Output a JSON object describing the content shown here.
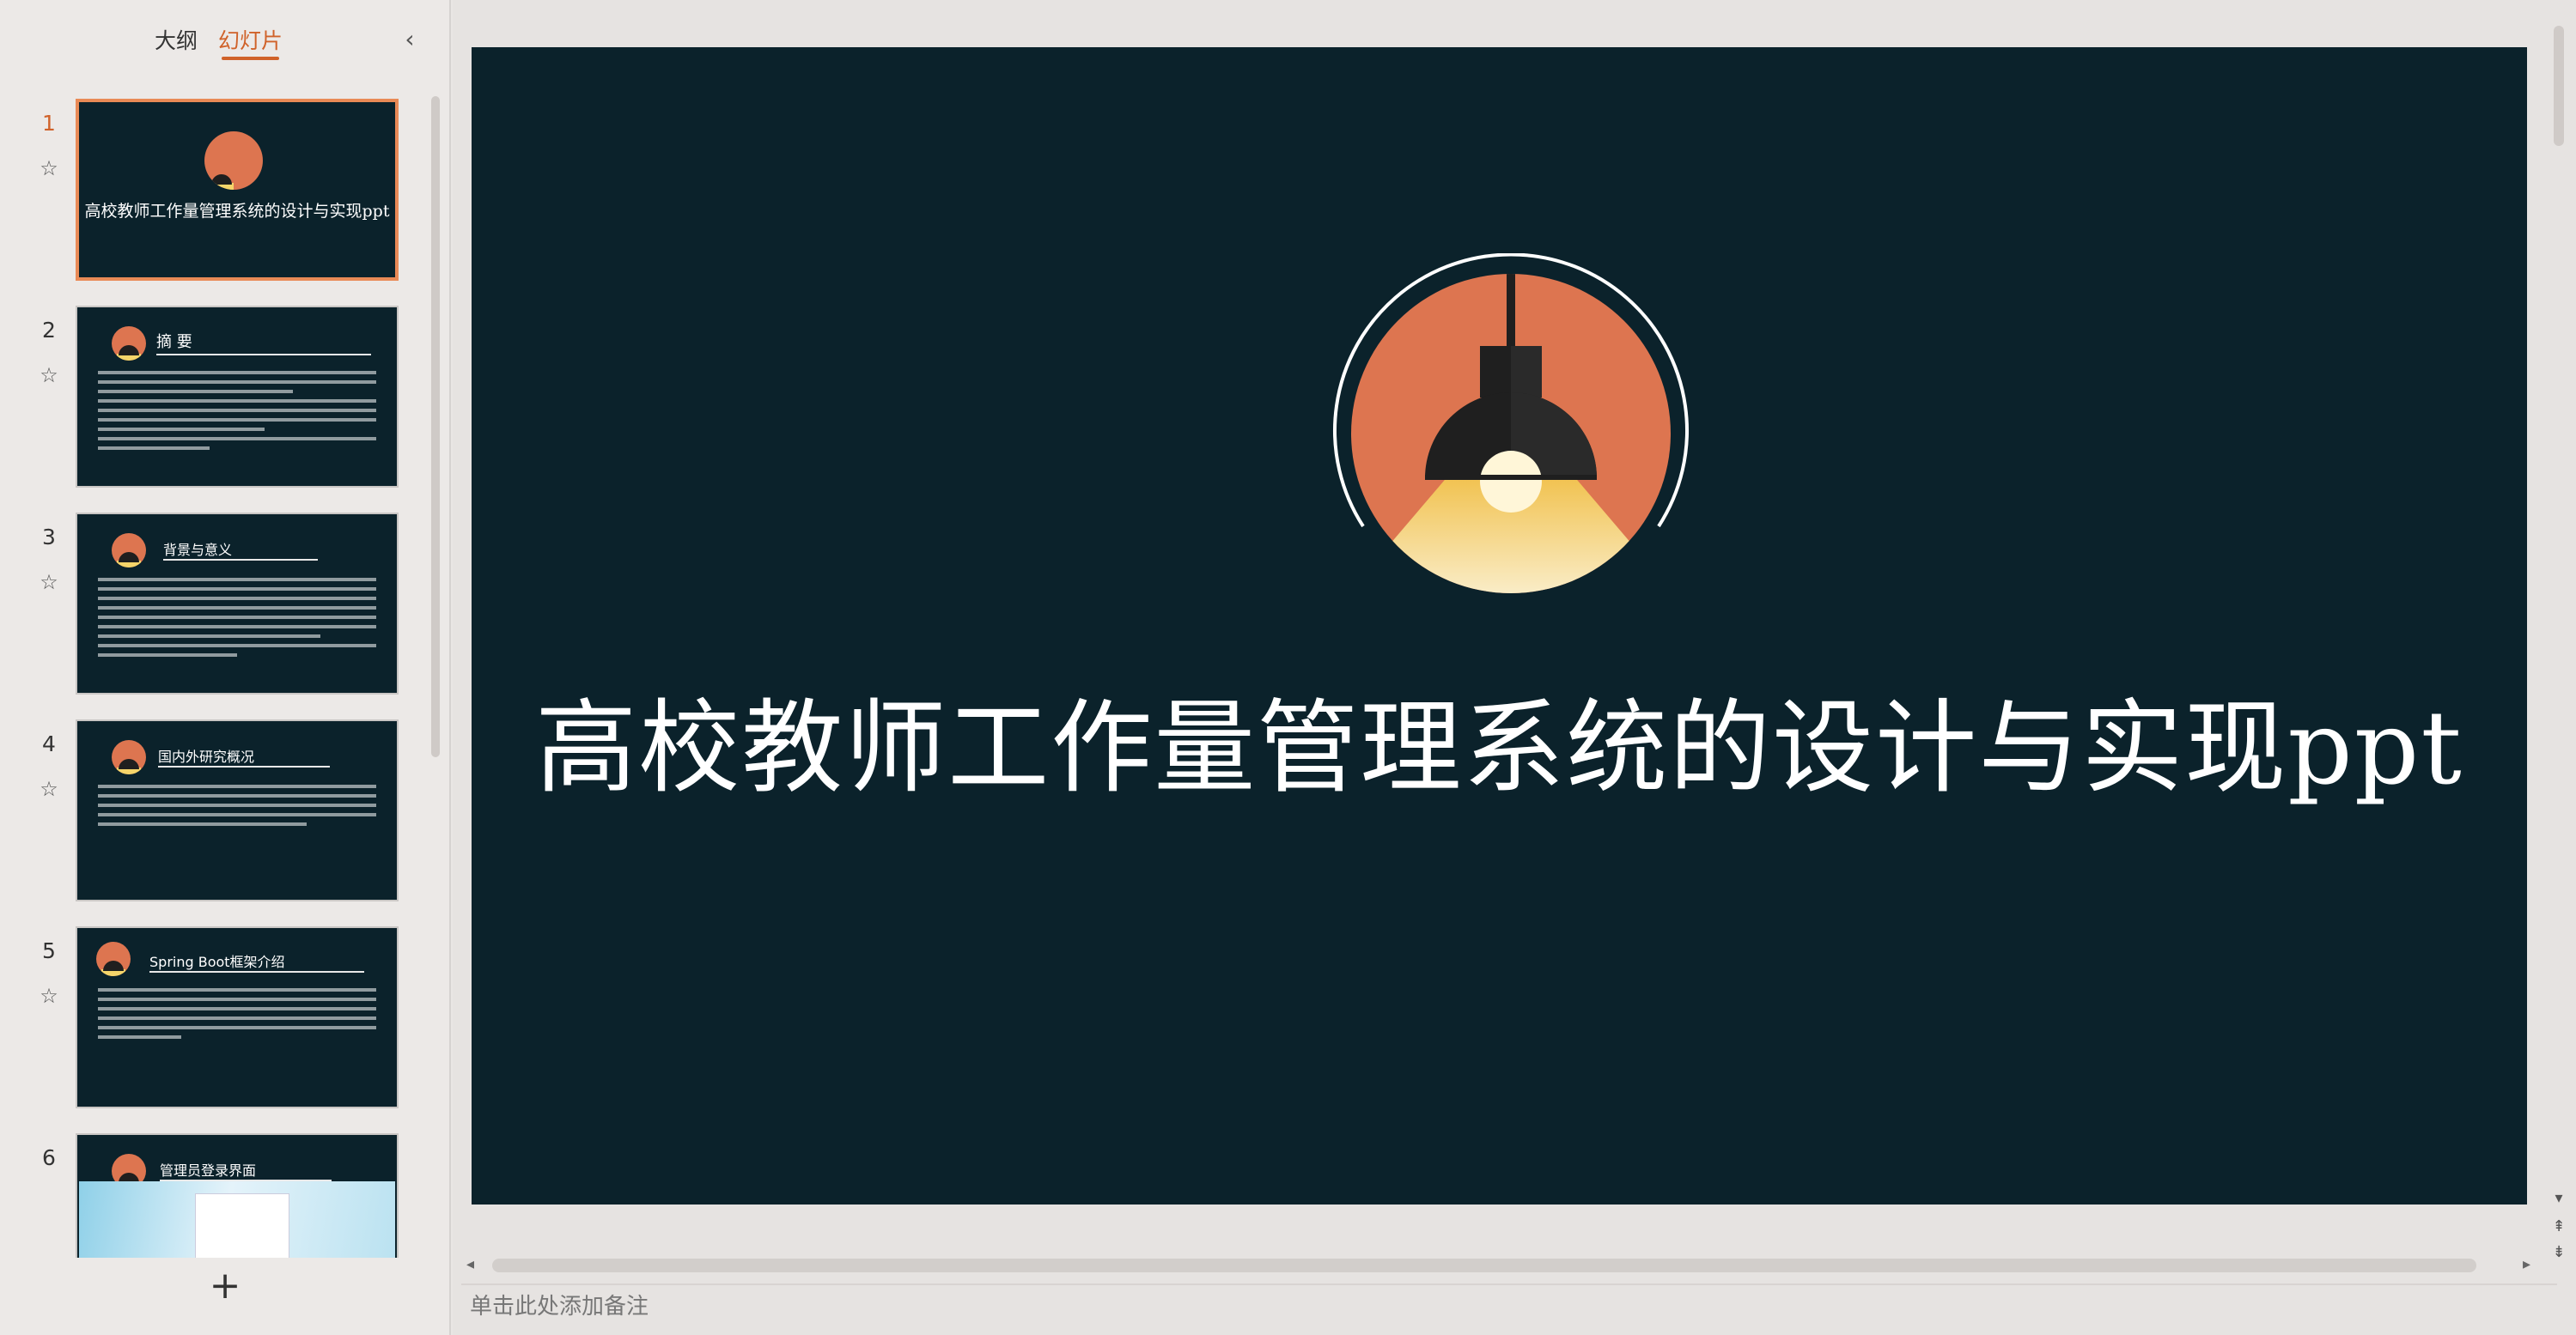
{
  "panel": {
    "tab_outline": "大纲",
    "tab_slides": "幻灯片",
    "collapse_icon": "‹",
    "add_label": "+"
  },
  "slides": [
    {
      "number": "1",
      "title": "高校教师工作量管理系统的设计与实现ppt"
    },
    {
      "number": "2",
      "title": "摘 要"
    },
    {
      "number": "3",
      "title": "背景与意义"
    },
    {
      "number": "4",
      "title": "国内外研究概况"
    },
    {
      "number": "5",
      "title": "Spring Boot框架介绍"
    },
    {
      "number": "6",
      "title": "管理员登录界面"
    }
  ],
  "current_slide": {
    "title": "高校教师工作量管理系统的设计与实现ppt"
  },
  "notes_placeholder": "单击此处添加备注",
  "colors": {
    "accent": "#d0622a",
    "slide_bg": "#0b222b",
    "lamp_orange": "#dd7550",
    "lamp_yellow": "#f5d56a"
  },
  "icons": [
    "chevron-left-icon",
    "star-icon",
    "plus-icon",
    "lamp-icon",
    "scroll-arrow-icon"
  ]
}
